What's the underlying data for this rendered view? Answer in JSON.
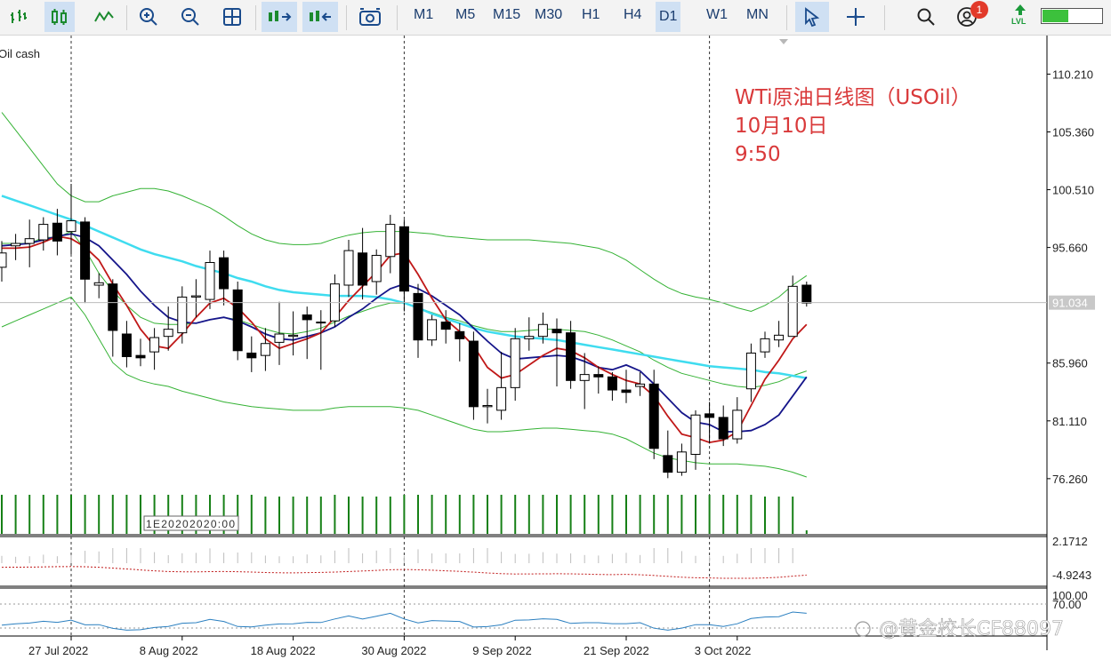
{
  "toolbar": {
    "icons": [
      "line-chart-type-icon",
      "candle-chart-type-icon",
      "line-type-icon",
      "zoom-in-icon",
      "zoom-out-icon",
      "grid-icon",
      "scroll-chart-icon",
      "shift-chart-icon",
      "screenshot-icon",
      "cursor-icon",
      "crosshair-icon",
      "search-icon",
      "account-icon",
      "signal-level-icon"
    ],
    "timeframes": [
      "M1",
      "M5",
      "M15",
      "M30",
      "H1",
      "H4",
      "D1",
      "W1",
      "MN"
    ],
    "active_timeframe": "D1",
    "notification_count": "1",
    "lvl_label": "LVL",
    "battery_level": 0.42
  },
  "chart": {
    "symbol_label": "Oil cash",
    "annotation_line1": "WTi原油日线图（USOil）",
    "annotation_line2": "10月10日",
    "annotation_line3": "9:50",
    "current_price": "91.034",
    "price_ticks": [
      "110.210",
      "105.360",
      "100.510",
      "95.660",
      "85.960",
      "81.110",
      "76.260"
    ],
    "macd_ticks": [
      "2.1712",
      "-4.9243"
    ],
    "osc_ticks": [
      "100.00",
      "70.00"
    ],
    "date_ticks": [
      "27 Jul 2022",
      "8 Aug 2022",
      "18 Aug 2022",
      "30 Aug 2022",
      "9 Sep 2022",
      "21 Sep 2022",
      "3 Oct 2022"
    ],
    "volume_note": "1E20202020:00",
    "watermark": "@黄金校长CF88097"
  },
  "colors": {
    "bull": "#ffffff",
    "bear": "#000000",
    "ma_fast": "#c01818",
    "ma_mid": "#15158a",
    "ma_slow": "#3fdcef",
    "bands": "#34b234",
    "volume": "#168016",
    "annotation": "#d9393a"
  },
  "chart_data": {
    "type": "candlestick",
    "x": [
      "2022-07-20",
      "2022-07-21",
      "2022-07-22",
      "2022-07-25",
      "2022-07-26",
      "2022-07-27",
      "2022-07-28",
      "2022-07-29",
      "2022-08-01",
      "2022-08-02",
      "2022-08-03",
      "2022-08-04",
      "2022-08-05",
      "2022-08-08",
      "2022-08-09",
      "2022-08-10",
      "2022-08-11",
      "2022-08-12",
      "2022-08-15",
      "2022-08-16",
      "2022-08-17",
      "2022-08-18",
      "2022-08-19",
      "2022-08-22",
      "2022-08-23",
      "2022-08-24",
      "2022-08-25",
      "2022-08-26",
      "2022-08-29",
      "2022-08-30",
      "2022-08-31",
      "2022-09-01",
      "2022-09-02",
      "2022-09-05",
      "2022-09-06",
      "2022-09-07",
      "2022-09-08",
      "2022-09-09",
      "2022-09-12",
      "2022-09-13",
      "2022-09-14",
      "2022-09-15",
      "2022-09-16",
      "2022-09-19",
      "2022-09-20",
      "2022-09-21",
      "2022-09-22",
      "2022-09-23",
      "2022-09-26",
      "2022-09-27",
      "2022-09-28",
      "2022-09-29",
      "2022-09-30",
      "2022-10-03",
      "2022-10-04",
      "2022-10-05",
      "2022-10-06",
      "2022-10-07",
      "2022-10-10"
    ],
    "open": [
      94.0,
      95.8,
      96.0,
      96.3,
      97.7,
      97.0,
      97.8,
      92.5,
      92.6,
      88.4,
      86.6,
      86.9,
      88.2,
      88.5,
      91.5,
      91.3,
      94.8,
      92.1,
      86.8,
      86.6,
      87.7,
      88.2,
      90.0,
      89.4,
      89.5,
      92.5,
      95.2,
      92.8,
      94.9,
      97.4,
      91.8,
      87.9,
      89.4,
      88.6,
      87.8,
      82.3,
      82.0,
      83.9,
      88.0,
      88.2,
      88.8,
      88.5,
      84.5,
      85.0,
      84.8,
      83.7,
      84.0,
      84.2,
      78.2,
      76.8,
      78.3,
      81.7,
      81.4,
      79.6,
      83.8,
      86.9,
      87.9,
      88.2,
      92.5
    ],
    "close": [
      95.2,
      96.0,
      96.4,
      97.6,
      96.2,
      97.9,
      93.0,
      92.7,
      88.7,
      86.5,
      86.4,
      88.1,
      88.8,
      91.5,
      91.6,
      94.4,
      92.2,
      87.0,
      86.4,
      87.6,
      88.4,
      88.3,
      89.6,
      89.4,
      92.6,
      95.4,
      92.5,
      95.0,
      97.6,
      92.0,
      87.9,
      89.6,
      88.8,
      88.0,
      82.3,
      82.4,
      83.9,
      88.0,
      88.2,
      89.2,
      88.5,
      84.5,
      85.0,
      84.8,
      83.7,
      83.5,
      84.2,
      78.8,
      76.8,
      78.5,
      81.6,
      81.4,
      79.6,
      82.0,
      86.8,
      88.0,
      88.3,
      92.4,
      91.0
    ],
    "high": [
      96.2,
      96.8,
      98.0,
      98.2,
      98.9,
      101.0,
      98.2,
      93.5,
      93.0,
      89.5,
      88.0,
      88.9,
      90.7,
      92.4,
      93.0,
      95.4,
      95.4,
      92.8,
      88.2,
      88.9,
      91.1,
      90.3,
      90.7,
      90.4,
      93.4,
      96.3,
      97.3,
      95.5,
      98.4,
      98.0,
      92.6,
      90.0,
      90.4,
      89.3,
      88.6,
      83.8,
      86.9,
      88.9,
      89.8,
      90.2,
      89.7,
      89.5,
      86.8,
      85.7,
      85.2,
      85.4,
      85.2,
      85.4,
      80.3,
      79.2,
      82.0,
      82.7,
      82.4,
      83.1,
      87.6,
      88.6,
      89.5,
      93.3,
      92.8
    ],
    "low": [
      92.8,
      94.6,
      94.0,
      95.4,
      95.0,
      95.1,
      91.0,
      91.4,
      86.5,
      85.6,
      85.7,
      85.4,
      87.0,
      87.6,
      89.8,
      90.5,
      90.8,
      86.2,
      85.2,
      85.3,
      85.8,
      86.6,
      86.3,
      85.4,
      89.0,
      91.5,
      91.3,
      91.7,
      93.5,
      90.3,
      86.4,
      87.4,
      87.6,
      86.1,
      81.2,
      80.9,
      81.2,
      82.8,
      87.0,
      87.6,
      84.0,
      83.8,
      82.1,
      83.4,
      82.8,
      82.6,
      83.2,
      77.9,
      76.3,
      76.5,
      77.0,
      79.2,
      79.0,
      79.2,
      82.7,
      86.4,
      87.3,
      88.2,
      90.7
    ],
    "ma_fast": [
      95.6,
      95.6,
      95.7,
      96.1,
      96.6,
      96.4,
      95.7,
      94.6,
      92.6,
      90.8,
      88.8,
      87.4,
      87.2,
      88.4,
      89.8,
      91.0,
      91.4,
      90.6,
      89.4,
      88.0,
      87.2,
      87.6,
      88.0,
      88.5,
      89.8,
      91.2,
      92.4,
      93.6,
      95.0,
      95.2,
      93.4,
      91.4,
      89.6,
      88.6,
      87.4,
      85.6,
      84.7,
      85.0,
      85.8,
      86.6,
      87.2,
      87.0,
      86.4,
      85.6,
      85.0,
      84.5,
      84.2,
      83.2,
      81.5,
      80.0,
      79.7,
      79.3,
      79.5,
      80.2,
      82.4,
      84.6,
      86.2,
      88.0,
      89.2
    ],
    "ma_mid": [
      95.8,
      95.9,
      96.0,
      96.3,
      96.6,
      96.8,
      96.5,
      95.8,
      94.6,
      93.4,
      92.0,
      90.8,
      89.8,
      89.4,
      89.3,
      89.6,
      89.8,
      89.5,
      89.0,
      88.4,
      88.0,
      87.9,
      88.2,
      88.5,
      89.0,
      89.8,
      90.5,
      91.4,
      92.2,
      92.6,
      92.2,
      91.6,
      90.8,
      90.0,
      88.9,
      87.8,
      86.8,
      86.3,
      86.4,
      86.5,
      86.6,
      86.5,
      86.1,
      85.6,
      85.4,
      85.8,
      85.3,
      84.2,
      83.0,
      81.8,
      81.0,
      80.8,
      80.2,
      80.2,
      80.3,
      80.8,
      81.6,
      83.2,
      84.8
    ],
    "ma_slow": [
      100.0,
      99.6,
      99.2,
      98.8,
      98.4,
      98.0,
      97.5,
      97.0,
      96.5,
      96.0,
      95.5,
      95.1,
      94.8,
      94.5,
      94.1,
      93.8,
      93.5,
      93.1,
      92.8,
      92.4,
      92.1,
      91.9,
      91.8,
      91.7,
      91.6,
      91.6,
      91.6,
      91.5,
      91.3,
      91.0,
      90.6,
      90.1,
      89.7,
      89.3,
      88.9,
      88.6,
      88.4,
      88.2,
      88.1,
      88.0,
      87.9,
      87.7,
      87.5,
      87.3,
      87.1,
      86.9,
      86.7,
      86.5,
      86.3,
      86.1,
      85.9,
      85.7,
      85.6,
      85.5,
      85.4,
      85.2,
      85.1,
      84.9,
      84.7
    ],
    "band_upper": [
      107.0,
      105.5,
      104.0,
      102.5,
      101.0,
      100.0,
      99.5,
      99.5,
      100.0,
      100.3,
      100.6,
      100.6,
      100.4,
      100.0,
      99.5,
      99.0,
      98.3,
      97.5,
      96.8,
      96.3,
      96.0,
      95.9,
      95.9,
      96.0,
      96.4,
      96.7,
      96.9,
      97.0,
      97.0,
      97.0,
      96.9,
      96.8,
      96.6,
      96.5,
      96.4,
      96.3,
      96.3,
      96.3,
      96.3,
      96.2,
      96.1,
      96.0,
      95.8,
      95.6,
      95.2,
      94.6,
      93.8,
      93.0,
      92.3,
      91.8,
      91.5,
      91.3,
      91.0,
      90.6,
      90.3,
      90.8,
      91.5,
      92.5,
      93.3
    ],
    "band_middle": [
      96.0,
      96.0,
      96.0,
      96.5,
      96.5,
      97.0,
      95.5,
      93.5,
      92.0,
      90.8,
      89.8,
      89.3,
      89.2,
      89.2,
      89.3,
      89.6,
      89.8,
      89.6,
      89.2,
      88.8,
      88.5,
      88.4,
      88.6,
      88.9,
      89.4,
      89.9,
      90.3,
      90.7,
      91.0,
      91.0,
      90.6,
      90.2,
      89.8,
      89.5,
      89.1,
      88.8,
      88.6,
      88.6,
      88.7,
      88.8,
      88.8,
      88.7,
      88.6,
      88.3,
      87.9,
      87.4,
      86.9,
      86.2,
      85.6,
      85.1,
      84.8,
      84.5,
      84.2,
      84.0,
      83.9,
      84.1,
      84.4,
      84.9,
      85.3
    ],
    "band_lower": [
      89.0,
      89.5,
      90.0,
      90.5,
      91.0,
      91.5,
      90.0,
      88.0,
      86.0,
      85.0,
      84.5,
      84.2,
      84.0,
      83.6,
      83.3,
      83.0,
      82.7,
      82.5,
      82.3,
      82.2,
      82.1,
      82.0,
      82.0,
      82.0,
      82.2,
      82.3,
      82.3,
      82.3,
      82.3,
      82.2,
      82.0,
      81.6,
      81.2,
      80.8,
      80.4,
      80.2,
      80.2,
      80.3,
      80.4,
      80.5,
      80.5,
      80.4,
      80.3,
      80.2,
      80.0,
      79.6,
      79.0,
      78.4,
      78.0,
      77.8,
      77.6,
      77.5,
      77.5,
      77.5,
      77.4,
      77.3,
      77.1,
      76.8,
      76.4
    ],
    "volume": [
      22,
      22,
      22,
      22,
      22,
      22,
      22,
      22,
      22,
      22,
      22,
      22,
      22,
      22,
      22,
      22,
      22,
      22,
      22,
      21,
      21,
      21,
      21,
      21,
      22,
      21,
      21,
      21,
      21,
      22,
      22,
      22,
      22,
      22,
      22,
      22,
      22,
      22,
      22,
      22,
      22,
      22,
      22,
      22,
      22,
      22,
      22,
      22,
      22,
      22,
      22,
      22,
      22,
      22,
      22,
      21,
      21,
      21,
      2
    ],
    "ylim": [
      72.0,
      113.0
    ],
    "current_price": 91.034
  }
}
